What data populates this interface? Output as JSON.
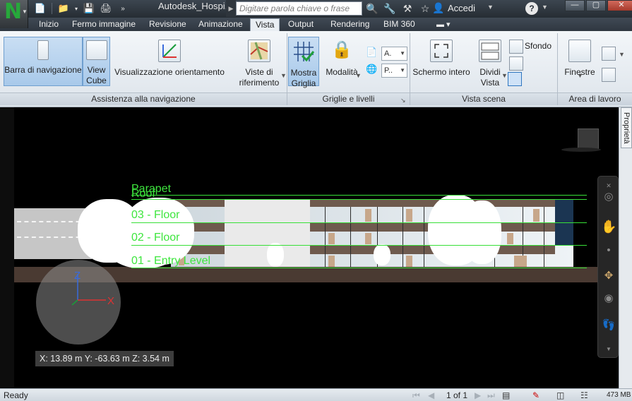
{
  "app": {
    "document_title": "Autodesk_Hospi...",
    "search_placeholder": "Digitare parola chiave o frase",
    "user_label": "Accedi",
    "help_label": "?"
  },
  "tabs": [
    {
      "label": "Inizio",
      "active": false
    },
    {
      "label": "Fermo immagine",
      "active": false
    },
    {
      "label": "Revisione",
      "active": false
    },
    {
      "label": "Animazione",
      "active": false
    },
    {
      "label": "Vista",
      "active": true
    },
    {
      "label": "Output",
      "active": false
    },
    {
      "label": "Rendering",
      "active": false
    },
    {
      "label": "BIM 360",
      "active": false
    }
  ],
  "ribbon": {
    "panels": {
      "navigation": "Assistenza alla navigazione",
      "grids": "Griglie e livelli",
      "scene": "Vista scena",
      "workspace": "Area di lavoro"
    },
    "buttons": {
      "nav_bar": "Barra di navigazione",
      "view_cube_1": "View",
      "view_cube_2": "Cube",
      "oriented_view": "Visualizzazione orientamento",
      "ref_views_1": "Viste di",
      "ref_views_2": "riferimento",
      "show_grid_1": "Mostra",
      "show_grid_2": "Griglia",
      "mode": "Modalità",
      "full_screen": "Schermo intero",
      "split_view_1": "Dividi",
      "split_view_2": "Vista",
      "background": "Sfondo",
      "windows": "Finestre",
      "combo_a": "A.",
      "combo_p": "P.."
    }
  },
  "viewport": {
    "properties_tab": "Proprietà",
    "grid_levels": [
      {
        "label": "Parapet"
      },
      {
        "label": "Roof"
      },
      {
        "label": "03 - Floor"
      },
      {
        "label": "02 - Floor"
      },
      {
        "label": "01 - Entry Level"
      }
    ],
    "axis_z": "Z",
    "axis_x": "X",
    "coordinates": "X: 13.89 m  Y: -63.63 m  Z: 3.54 m"
  },
  "status": {
    "text": "Ready",
    "page": "1 of 1",
    "memory": "473 MB"
  },
  "colors": {
    "grid_green": "#3ee63e",
    "axis_blue": "#3a6bdc",
    "axis_red": "#dd3333",
    "brand_green": "#27a83b"
  }
}
